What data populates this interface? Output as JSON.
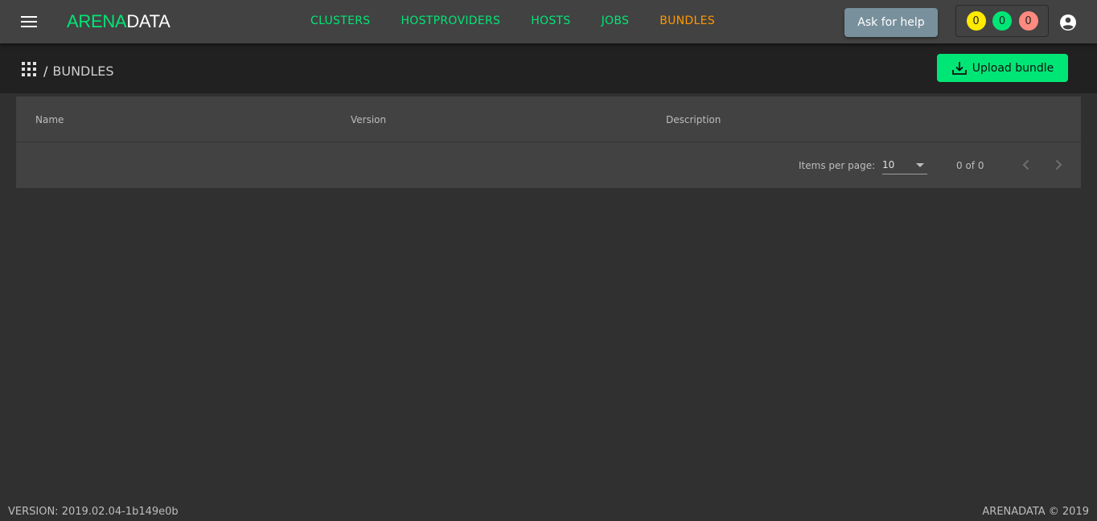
{
  "header": {
    "menu_icon": "menu-icon",
    "logo": {
      "part1": "ARENA",
      "part2": "DATA"
    },
    "nav": [
      {
        "label": "CLUSTERS",
        "active": false
      },
      {
        "label": "HOSTPROVIDERS",
        "active": false
      },
      {
        "label": "HOSTS",
        "active": false
      },
      {
        "label": "JOBS",
        "active": false
      },
      {
        "label": "BUNDLES",
        "active": true
      }
    ],
    "help_label": "Ask for help",
    "counters": {
      "yellow": "0",
      "green": "0",
      "red": "0"
    },
    "account_icon": "account-circle-icon"
  },
  "toolbar": {
    "apps_icon": "apps-grid-icon",
    "breadcrumb_sep": "/",
    "breadcrumb": "BUNDLES",
    "upload_label": "Upload bundle",
    "upload_icon": "download-tray-icon"
  },
  "table": {
    "columns": [
      "Name",
      "Version",
      "Description"
    ],
    "rows": []
  },
  "paginator": {
    "items_per_page_label": "Items per page:",
    "items_per_page": "10",
    "range": "0 of 0",
    "prev_icon": "chevron-left-icon",
    "next_icon": "chevron-right-icon"
  },
  "footer": {
    "version": "VERSION: 2019.02.04-1b149e0b",
    "copyright": "ARENADATA © 2019"
  },
  "colors": {
    "accent": "#00e676",
    "active_nav": "#ff9800",
    "background": "#303030",
    "toolbar": "#424242"
  }
}
